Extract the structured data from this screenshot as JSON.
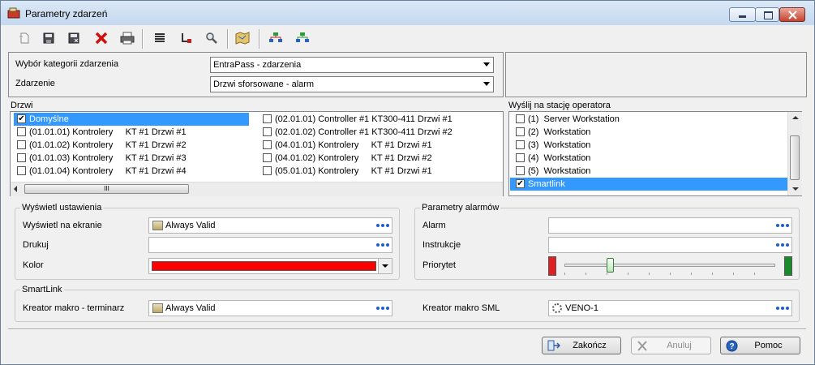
{
  "window": {
    "title": "Parametry zdarzeń"
  },
  "toolbar": {
    "icons": [
      "new-doc-icon",
      "save-icon",
      "save-all-icon",
      "delete-icon",
      "print-icon",
      "list-icon",
      "tree-icon",
      "find-icon",
      "map-icon",
      "network-icon",
      "network-down-icon"
    ]
  },
  "selection": {
    "category_label": "Wybór kategorii zdarzenia",
    "category_value": "EntraPass - zdarzenia",
    "event_label": "Zdarzenie",
    "event_value": "Drzwi sforsowane - alarm"
  },
  "doors": {
    "title": "Drzwi",
    "column1": [
      {
        "label": "Domyślne",
        "checked": true,
        "selected": true
      },
      {
        "label": "(01.01.01) Kontrolery     KT #1 Drzwi #1",
        "checked": false
      },
      {
        "label": "(01.01.02) Kontrolery     KT #1 Drzwi #2",
        "checked": false
      },
      {
        "label": "(01.01.03) Kontrolery     KT #1 Drzwi #3",
        "checked": false
      },
      {
        "label": "(01.01.04) Kontrolery     KT #1 Drzwi #4",
        "checked": false
      }
    ],
    "column2": [
      {
        "label": "(02.01.01) Controller #1 KT300-411 Drzwi #1",
        "checked": false
      },
      {
        "label": "(02.01.02) Controller #1 KT300-411 Drzwi #2",
        "checked": false
      },
      {
        "label": "(04.01.01) Kontrolery     KT #1 Drzwi #1",
        "checked": false
      },
      {
        "label": "(04.01.02) Kontrolery     KT #1 Drzwi #2",
        "checked": false
      },
      {
        "label": "(05.01.01) Kontrolery     KT #1 Drzwi #1",
        "checked": false
      }
    ],
    "scroll_label": "III"
  },
  "operators": {
    "title": "Wyślij na stację operatora",
    "items": [
      {
        "label": "(1)  Server Workstation",
        "checked": false
      },
      {
        "label": "(2)  Workstation",
        "checked": false
      },
      {
        "label": "(3)  Workstation",
        "checked": false
      },
      {
        "label": "(4)  Workstation",
        "checked": false
      },
      {
        "label": "(5)  Workstation",
        "checked": false
      },
      {
        "label": "Smartlink",
        "checked": true,
        "selected": true
      }
    ]
  },
  "display": {
    "title": "Wyświetl ustawienia",
    "show_label": "Wyświetl na ekranie",
    "show_value": "Always Valid",
    "print_label": "Drukuj",
    "print_value": "",
    "color_label": "Kolor",
    "color_value": "#ff0000"
  },
  "alarm": {
    "title": "Parametry alarmów",
    "alarm_label": "Alarm",
    "alarm_value": "",
    "instructions_label": "Instrukcje",
    "instructions_value": "",
    "priority_label": "Priorytet",
    "priority_level": 0.2,
    "low_color": "#e02020",
    "high_color": "#1a8a2a"
  },
  "smartlink": {
    "title": "SmartLink",
    "schedule_label": "Kreator makro - terminarz",
    "schedule_value": "Always Valid",
    "sml_label": "Kreator makro SML",
    "sml_value": "VENO-1"
  },
  "buttons": {
    "finish": "Zakończ",
    "cancel": "Anuluj",
    "help": "Pomoc"
  }
}
